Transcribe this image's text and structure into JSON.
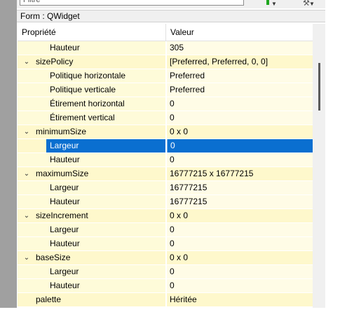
{
  "filter": {
    "placeholder": "Filtre"
  },
  "form_label": "Form : QWidget",
  "header": {
    "property": "Propriété",
    "value": "Valeur"
  },
  "rows": [
    {
      "level": 1,
      "expandable": false,
      "name": "Hauteur",
      "value": "305"
    },
    {
      "level": 0,
      "expandable": true,
      "name": "sizePolicy",
      "value": "[Preferred, Preferred, 0, 0]"
    },
    {
      "level": 1,
      "expandable": false,
      "name": "Politique horizontale",
      "value": "Preferred"
    },
    {
      "level": 1,
      "expandable": false,
      "name": "Politique verticale",
      "value": "Preferred"
    },
    {
      "level": 1,
      "expandable": false,
      "name": "Étirement horizontal",
      "value": "0"
    },
    {
      "level": 1,
      "expandable": false,
      "name": "Étirement vertical",
      "value": "0"
    },
    {
      "level": 0,
      "expandable": true,
      "name": "minimumSize",
      "value": "0 x 0"
    },
    {
      "level": 1,
      "expandable": false,
      "name": "Largeur",
      "value": "0",
      "selected": true
    },
    {
      "level": 1,
      "expandable": false,
      "name": "Hauteur",
      "value": "0"
    },
    {
      "level": 0,
      "expandable": true,
      "name": "maximumSize",
      "value": "16777215 x 16777215"
    },
    {
      "level": 1,
      "expandable": false,
      "name": "Largeur",
      "value": "16777215"
    },
    {
      "level": 1,
      "expandable": false,
      "name": "Hauteur",
      "value": "16777215"
    },
    {
      "level": 0,
      "expandable": true,
      "name": "sizeIncrement",
      "value": "0 x 0"
    },
    {
      "level": 1,
      "expandable": false,
      "name": "Largeur",
      "value": "0"
    },
    {
      "level": 1,
      "expandable": false,
      "name": "Hauteur",
      "value": "0"
    },
    {
      "level": 0,
      "expandable": true,
      "name": "baseSize",
      "value": "0 x 0"
    },
    {
      "level": 1,
      "expandable": false,
      "name": "Largeur",
      "value": "0"
    },
    {
      "level": 1,
      "expandable": false,
      "name": "Hauteur",
      "value": "0"
    },
    {
      "level": 0,
      "expandable": false,
      "name": "palette",
      "value": "Héritée"
    }
  ],
  "icons": {
    "expand": "chevron-down-icon",
    "dropdown": "caret-down-icon",
    "tool": "wrench-icon"
  },
  "colors": {
    "selection": "#0a6fd0",
    "row_band": "#fef8cc",
    "accent_green": "#1fa71f"
  }
}
